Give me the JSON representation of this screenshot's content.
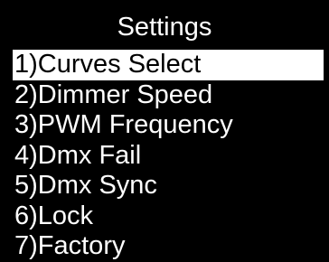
{
  "screen": {
    "title": "Settings",
    "selected_index": 0,
    "colors": {
      "background": "#000000",
      "text": "#ffffff",
      "highlight_bg": "#ffffff",
      "highlight_text": "#000000"
    },
    "items": [
      {
        "label": "1)Curves Select"
      },
      {
        "label": "2)Dimmer Speed"
      },
      {
        "label": "3)PWM Frequency"
      },
      {
        "label": "4)Dmx Fail"
      },
      {
        "label": "5)Dmx Sync"
      },
      {
        "label": "6)Lock"
      },
      {
        "label": "7)Factory"
      }
    ]
  }
}
